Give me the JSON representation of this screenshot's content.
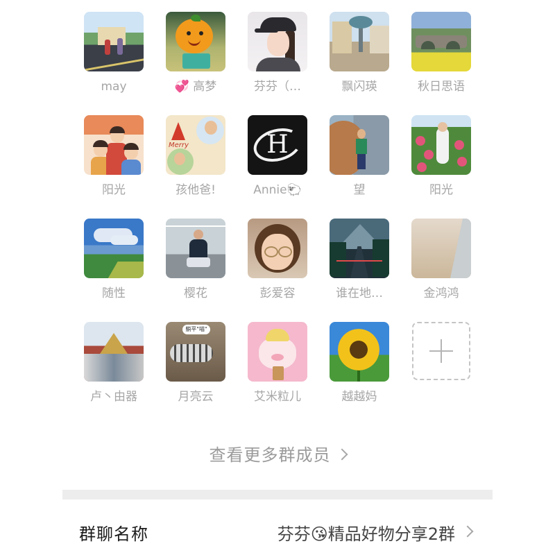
{
  "members": [
    {
      "name": "may",
      "avatar": "street-scene"
    },
    {
      "name": "💞 高梦",
      "avatar": "orange-character"
    },
    {
      "name": "芬芬（…",
      "avatar": "woman-in-cap"
    },
    {
      "name": "飘闪瑛",
      "avatar": "plaza-statue"
    },
    {
      "name": "秋日思语",
      "avatar": "bridge-landscape"
    },
    {
      "name": "阳光",
      "avatar": "cartoon-family"
    },
    {
      "name": "孩他爸!",
      "avatar": "christmas-kids-collage",
      "text": "Merry"
    },
    {
      "name": "Annie🐑",
      "avatar": "letter-h-logo",
      "text": "H"
    },
    {
      "name": "望",
      "avatar": "child-by-wall"
    },
    {
      "name": "阳光",
      "avatar": "woman-in-flowers"
    },
    {
      "name": "随性",
      "avatar": "sky-field"
    },
    {
      "name": "樱花",
      "avatar": "woman-sitting-railing"
    },
    {
      "name": "彭爱容",
      "avatar": "girl-with-glasses"
    },
    {
      "name": "谁在地…",
      "avatar": "mountain-road"
    },
    {
      "name": "金鸿鸿",
      "avatar": "beach-sand"
    },
    {
      "name": "卢丶由器",
      "avatar": "palace-tower"
    },
    {
      "name": "月亮云",
      "avatar": "tabby-cat",
      "text": "躺平\"喵\""
    },
    {
      "name": "艾米粒儿",
      "avatar": "cartoon-pig"
    },
    {
      "name": "越越妈",
      "avatar": "sunflower"
    }
  ],
  "add_member": {
    "icon": "plus-icon"
  },
  "more_members": {
    "label": "查看更多群成员",
    "icon": "chevron-right-icon"
  },
  "group_name_row": {
    "label": "群聊名称",
    "value": "芬芬😘精品好物分享2群",
    "icon": "chevron-right-icon"
  },
  "colors": {
    "name_text": "#a6a6a6",
    "divider": "#ededed",
    "label_text": "#1a1a1a"
  }
}
